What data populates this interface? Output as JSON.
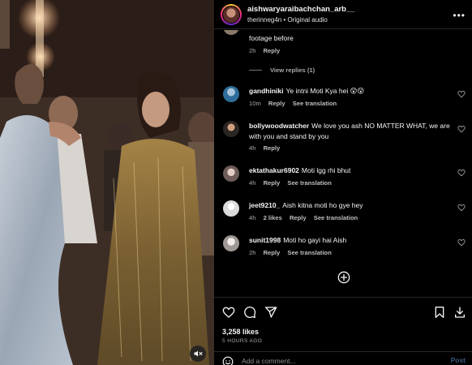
{
  "header": {
    "username": "aishwaryaraibachchan_arb__",
    "subtitle_user": "therinneg4n",
    "subtitle_sep": " • ",
    "subtitle_audio": "Original audio",
    "more_icon": "more-horizontal-icon"
  },
  "comments": [
    {
      "user": "",
      "text": "footage before",
      "time": "2h",
      "likes": "",
      "reply": "Reply",
      "translation": "",
      "avatar_color": "#8a7a6a",
      "view_replies": "View replies (1)"
    },
    {
      "user": "gandhiniki",
      "text": "Ye intni Moti Kya hei 😲😲",
      "time": "10m",
      "likes": "",
      "reply": "Reply",
      "translation": "See translation",
      "avatar_color": "#4a88b8"
    },
    {
      "user": "bollywoodwatcher",
      "text": "We love you ash NO MATTER WHAT, we are with you and stand by you",
      "time": "4h",
      "likes": "",
      "reply": "Reply",
      "translation": "",
      "avatar_color": "#3b3a38"
    },
    {
      "user": "ektathakur6902",
      "text": "Moti lgg rhi bhut",
      "time": "4h",
      "likes": "",
      "reply": "Reply",
      "translation": "See translation",
      "avatar_color": "#7a6a66"
    },
    {
      "user": "jeet9210_",
      "text": "Aish kitna moti ho gye hey",
      "time": "4h",
      "likes": "2 likes",
      "reply": "Reply",
      "translation": "See translation",
      "avatar_color": "#dbdbdb"
    },
    {
      "user": "sunit1998",
      "text": "Moti ho gayi hai Aish",
      "time": "2h",
      "likes": "",
      "reply": "Reply",
      "translation": "See translation",
      "avatar_color": "#b0aaa8"
    }
  ],
  "load_more_icon": "plus-circle-icon",
  "actions": {
    "like_icon": "heart-icon",
    "comment_icon": "comment-icon",
    "share_icon": "send-icon",
    "save_icon": "bookmark-icon",
    "download_icon": "download-icon"
  },
  "likes": "3,258 likes",
  "time_ago": "5 HOURS AGO",
  "comment_box": {
    "placeholder": "Add a comment...",
    "post_label": "Post"
  },
  "media": {
    "mute_icon": "speaker-muted-icon"
  },
  "colors": {
    "background": "#000000",
    "text": "#f5f5f5",
    "muted": "#a8a8a8",
    "post_button": "#3b5a7a"
  }
}
